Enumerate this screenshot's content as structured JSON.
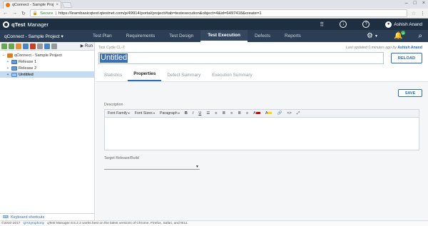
{
  "browser": {
    "tab_title": "qConnect - Sample Projec",
    "secure_label": "Secure",
    "url": "https://learnbasicqtest.qtestnet.com/p/49914/portal/project#tab=testexecution&object=4&id=6497418&create=1"
  },
  "app": {
    "brand": "qTest",
    "product": "Manager",
    "notification_count": "6",
    "user_name": "Ashish Anand"
  },
  "project_nav": {
    "project": "qConnect - Sample Project",
    "tabs": [
      "Test Plan",
      "Requirements",
      "Test Design",
      "Test Execution",
      "Defects",
      "Reports"
    ],
    "active_tab": "Test Execution"
  },
  "tree": {
    "toolbar_run_label": "Run",
    "root": "qConnect - Sample Project",
    "items": [
      "Release 1",
      "Release 2",
      "Untitled"
    ],
    "selected": "Untitled"
  },
  "keyboard_shortcuts_label": "Keyboard shortcuts",
  "main": {
    "cycle_label": "Test Cycle CL-7",
    "last_updated": "Last updated 0 minutes ago by",
    "last_updated_by": "Ashish Anand",
    "title": "Untitled",
    "reload_label": "RELOAD",
    "subtabs": [
      "Statistics",
      "Properties",
      "Defect Summary",
      "Execution Summary"
    ],
    "active_subtab": "Properties",
    "save_label": "SAVE",
    "description_label": "Description",
    "editor_toolbar": {
      "font_family": "Font Family",
      "font_sizes": "Font Sizes",
      "paragraph": "Paragraph"
    },
    "target_release_label": "Target Release/Build"
  },
  "status_bar": {
    "copyright": "©2010-2017",
    "company_link": "QASymphony",
    "notice": "qTest Manager 8.5.2.2 works best on the latest versions of Chrome, Firefox, Safari, and IE11."
  },
  "colors": {
    "header_bg": "#1f2f42",
    "nav_bg": "#2c3e55",
    "accent": "#2a6ebb",
    "selected_row": "#c5dbf2"
  }
}
